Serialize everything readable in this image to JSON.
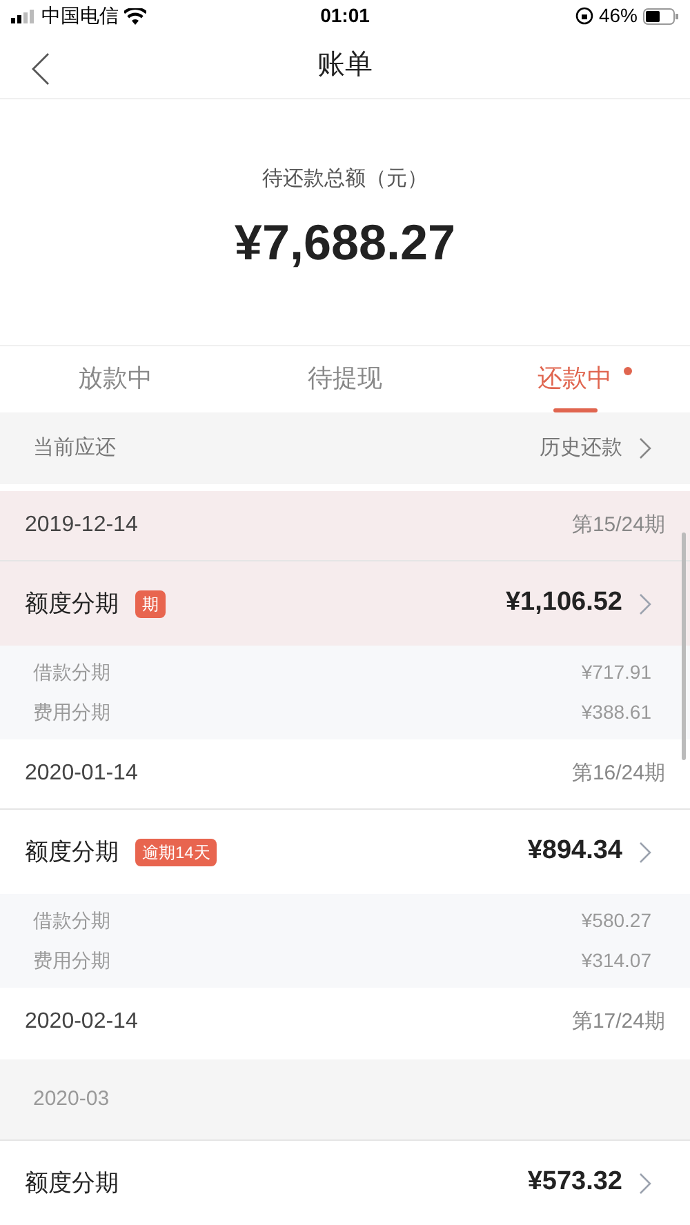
{
  "status_bar": {
    "carrier": "中国电信",
    "time": "01:01",
    "battery": "46%"
  },
  "nav": {
    "title": "账单"
  },
  "summary": {
    "label": "待还款总额（元）",
    "amount": "¥7,688.27"
  },
  "tabs": [
    {
      "label": "放款中",
      "selected": false,
      "dot": false
    },
    {
      "label": "待提现",
      "selected": false,
      "dot": false
    },
    {
      "label": "还款中",
      "selected": true,
      "dot": true
    }
  ],
  "section_header": {
    "title": "当前应还",
    "link": "历史还款"
  },
  "entries": [
    {
      "kind": "date",
      "date": "2019-12-14",
      "period": "第15/24期",
      "highlighted": true
    },
    {
      "kind": "item",
      "label": "额度分期",
      "badge": "期",
      "amount": "¥1,106.52",
      "highlighted": true
    },
    {
      "kind": "breakdown",
      "rows": [
        {
          "label": "借款分期",
          "amount": "¥717.91"
        },
        {
          "label": "费用分期",
          "amount": "¥388.61"
        }
      ]
    },
    {
      "kind": "date",
      "date": "2020-01-14",
      "period": "第16/24期",
      "highlighted": false
    },
    {
      "kind": "item",
      "label": "额度分期",
      "badge": "逾期14天",
      "amount": "¥894.34",
      "highlighted": false
    },
    {
      "kind": "breakdown",
      "rows": [
        {
          "label": "借款分期",
          "amount": "¥580.27"
        },
        {
          "label": "费用分期",
          "amount": "¥314.07"
        }
      ]
    },
    {
      "kind": "date",
      "date": "2020-02-14",
      "period": "第17/24期",
      "highlighted": false
    },
    {
      "kind": "month",
      "label": "2020-03"
    },
    {
      "kind": "item",
      "label": "额度分期",
      "amount": "¥573.32",
      "highlighted": false
    }
  ]
}
